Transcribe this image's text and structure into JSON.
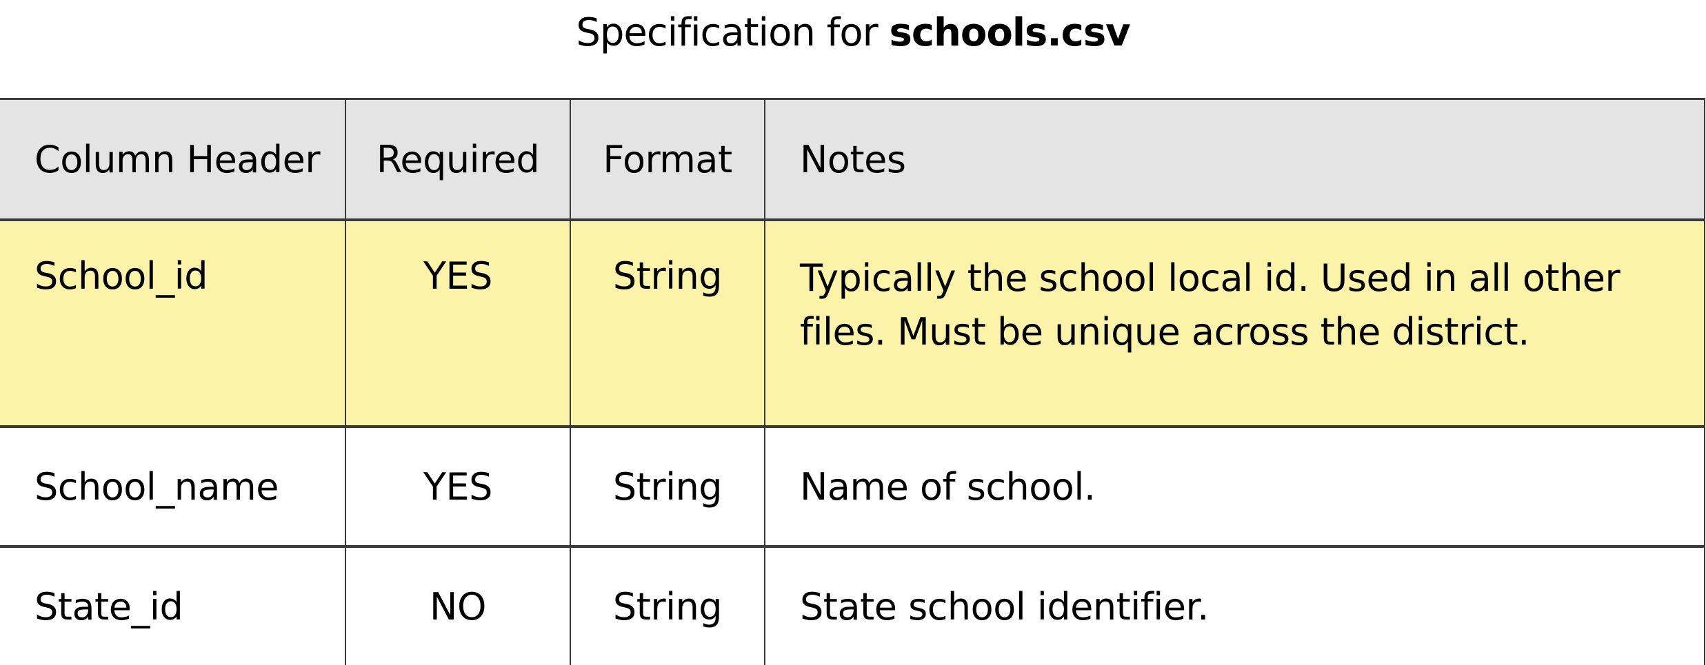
{
  "title": {
    "prefix": "Specification for ",
    "filename": "schools.csv"
  },
  "table": {
    "headers": [
      "Column Header",
      "Required",
      "Format",
      "Notes"
    ],
    "rows": [
      {
        "column_header": "School_id",
        "required": "YES",
        "format": "String",
        "notes": "Typically the school local id. Used in all other files. Must be unique across the district.",
        "emphasized": true,
        "highlighted": true
      },
      {
        "column_header": "School_name",
        "required": "YES",
        "format": "String",
        "notes": "Name of school.",
        "emphasized": true,
        "highlighted": false
      },
      {
        "column_header": "State_id",
        "required": "NO",
        "format": "String",
        "notes": "State school identifier.",
        "emphasized": false,
        "highlighted": false
      }
    ]
  },
  "colors": {
    "header_background": "#e4e4e4",
    "highlight_row_background": "#fbf3a8",
    "border": "#3a3a3a"
  }
}
